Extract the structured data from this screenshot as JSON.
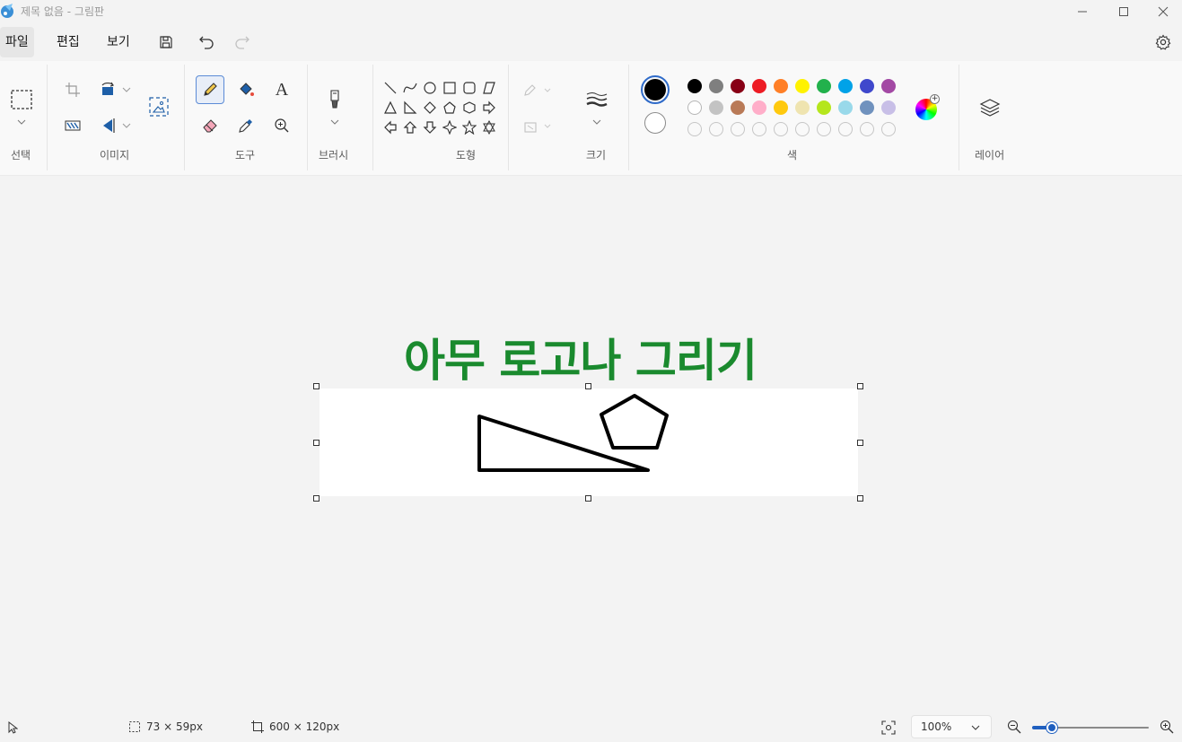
{
  "window": {
    "title": "제목 없음 - 그림판",
    "controls": [
      "minimize-icon",
      "maximize-icon",
      "close-icon"
    ]
  },
  "menu": {
    "file": "파일",
    "edit": "편집",
    "view": "보기"
  },
  "ribbon": {
    "groups": {
      "select": "선택",
      "image": "이미지",
      "tools": "도구",
      "brush": "브러시",
      "shapes": "도형",
      "size": "크기",
      "colors": "색",
      "layers": "레이어"
    },
    "text_tool_glyph": "A",
    "colors": {
      "primary": "#000000",
      "secondary": "#ffffff",
      "palette_row1": [
        "#000000",
        "#7f7f7f",
        "#880015",
        "#ed1c24",
        "#ff7f27",
        "#fff200",
        "#22b14c",
        "#00a2e8",
        "#3f48cc",
        "#a349a4"
      ],
      "palette_row2": [
        "#ffffff",
        "#c3c3c3",
        "#b97a57",
        "#ffaec9",
        "#ffc90e",
        "#efe4b0",
        "#b5e61d",
        "#99d9ea",
        "#7092be",
        "#c8bfe7"
      ]
    }
  },
  "canvas": {
    "banner_text": "아무 로고나 그리기",
    "banner_color": "#1a8a2e"
  },
  "status": {
    "selection_size": "73 × 59px",
    "canvas_size": "600 × 120px",
    "zoom": "100%",
    "zoom_level": 0.17
  }
}
